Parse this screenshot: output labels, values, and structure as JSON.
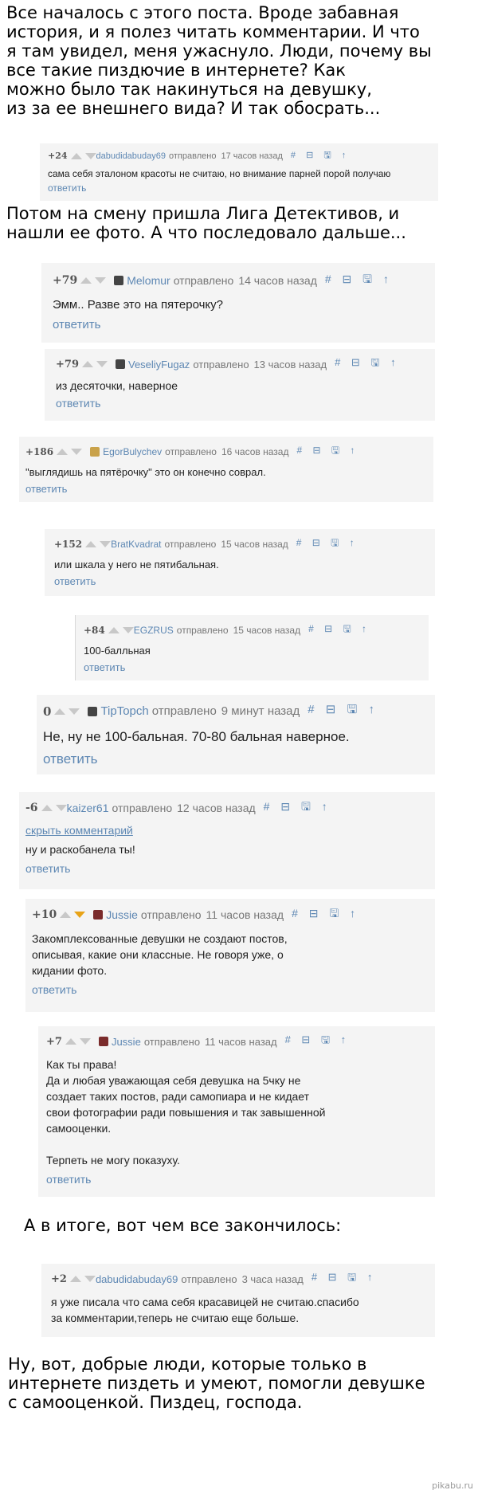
{
  "narration": {
    "intro": "Все началось с этого поста. Вроде забавная\nистория, и я полез читать комментарии. И что\nя там увидел, меня ужаснуло. Люди, почему вы\nвсе такие пиздючие в интернете? Как\nможно было так накинуться на девушку,\nиз за ее внешнего вида? И так обосрать...",
    "middle": "Потом на смену пришла Лига Детективов, и\nнашли ее фото. А что последовало дальше...",
    "ending_lead": "А в итоге, вот чем все закончилось:",
    "conclusion": "Ну, вот, добрые люди, которые только в\nинтернете пиздеть и умеют, помогли девушке\nс самооценкой. Пиздец, господа."
  },
  "ui": {
    "sent_label": "отправлено",
    "reply_label": "ответить",
    "tools_icons": "# ⊟ 🖫 ↑"
  },
  "comments": [
    {
      "score": "+24",
      "author": "dabudidabuday69",
      "time": "17 часов назад",
      "text": "сама себя эталоном красоты не считаю, но внимание парней порой получаю"
    },
    {
      "score": "+79",
      "author": "Melomur",
      "time": "14 часов назад",
      "text": "Эмм.. Разве это на пятерочку?"
    },
    {
      "score": "+79",
      "author": "VeseliyFugaz",
      "time": "13 часов назад",
      "text": "из десяточки, наверное"
    },
    {
      "score": "+186",
      "author": "EgorBulychev",
      "time": "16 часов назад",
      "text": "\"выглядишь на пятёрочку\" это он конечно соврал."
    },
    {
      "score": "+152",
      "author": "BratKvadrat",
      "time": "15 часов назад",
      "text": "или шкала у него не пятибальная."
    },
    {
      "score": "+84",
      "author": "EGZRUS",
      "time": "15 часов назад",
      "text": "100-балльная"
    },
    {
      "score": "0",
      "author": "TipTopch",
      "time": "9 минут назад",
      "text": "Не, ну не 100-бальная. 70-80 бальная наверное."
    },
    {
      "score": "-6",
      "author": "kaizer61",
      "time": "12 часов назад",
      "hide": "скрыть комментарий",
      "text": "ну и раскобанела ты!"
    },
    {
      "score": "+10",
      "author": "Jussie",
      "time": "11 часов назад",
      "text": "Закомплексованные девушки не создают постов,\nописывая, какие они классные. Не говоря уже, о\nкидании фото."
    },
    {
      "score": "+7",
      "author": "Jussie",
      "time": "11 часов назад",
      "text": "Как ты права!\nДа и любая уважающая себя девушка на 5чку не\nсоздает таких постов, ради самопиара и не кидает\nсвои фотографии ради повышения и так завышенной\nсамооценки.\n\nТерпеть не могу показуху."
    },
    {
      "score": "+2",
      "author": "dabudidabuday69",
      "time": "3 часа назад",
      "text": "я уже писала что сама себя красавицей не считаю.спасибо\nза комментарии,теперь не считаю еще больше."
    }
  ],
  "watermark": "pikabu.ru"
}
